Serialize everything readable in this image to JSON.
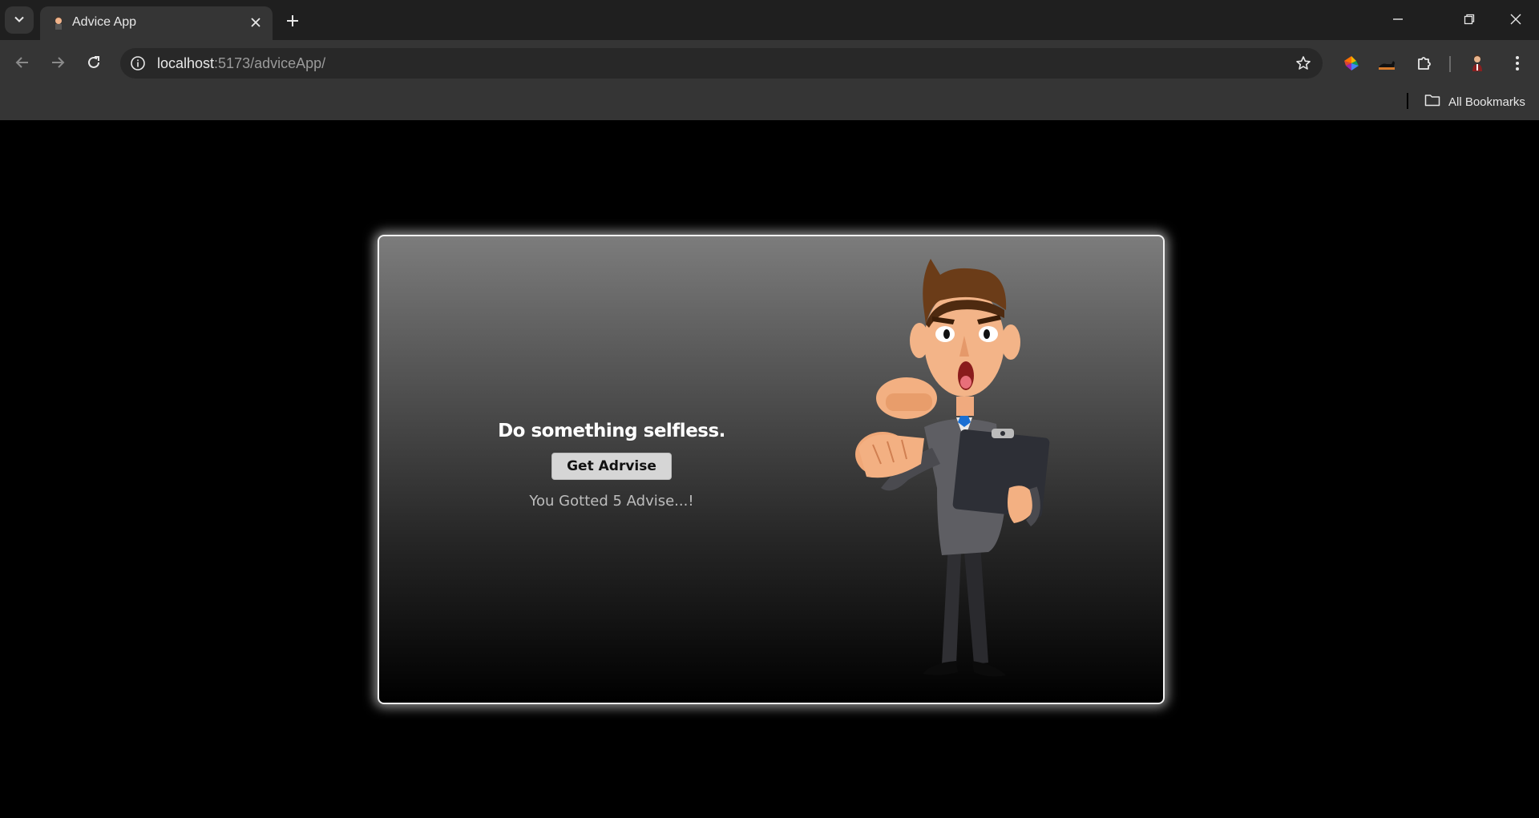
{
  "browser": {
    "tab_title": "Advice App",
    "url_host": "localhost",
    "url_rest": ":5173/adviceApp/",
    "bookmarks_label": "All Bookmarks"
  },
  "icons": {
    "tab_search": "chevron-down-icon",
    "tab_close": "close-icon",
    "new_tab": "plus-icon",
    "back": "arrow-left-icon",
    "forward": "arrow-right-icon",
    "reload": "reload-icon",
    "site_info": "info-icon",
    "bookmark": "star-icon",
    "extensions": "puzzle-icon",
    "menu": "kebab-icon",
    "folder": "folder-icon"
  },
  "advice": {
    "text": "Do something selfless.",
    "button_label": "Get Adrvise",
    "count_text": "You Gotted 5 Advise...!"
  },
  "colors": {
    "page_background": "#000000",
    "card_border": "#f2f2f2",
    "button_background": "#d6d6d6"
  }
}
